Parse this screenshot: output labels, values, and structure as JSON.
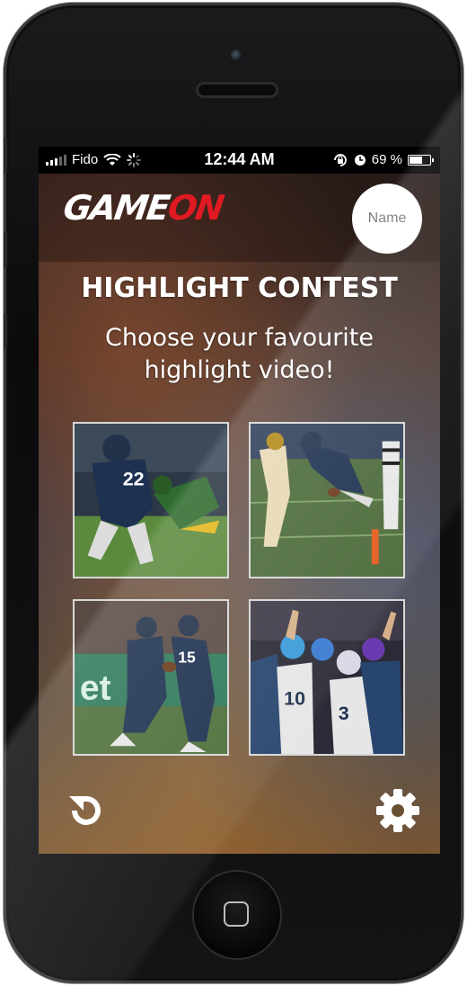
{
  "status_bar": {
    "carrier": "Fido",
    "time": "12:44 AM",
    "battery": "69 %",
    "battery_level": 0.69
  },
  "header": {
    "logo_main": "GAME",
    "logo_accent": "ON",
    "name_button": "Name"
  },
  "content": {
    "title": "HIGHLIGHT CONTEST",
    "subtitle": "Choose your favourite highlight video!",
    "videos": [
      {
        "icon": "football-tackle-thumbnail"
      },
      {
        "icon": "football-catch-thumbnail"
      },
      {
        "icon": "football-handoff-thumbnail"
      },
      {
        "icon": "fans-celebrating-thumbnail"
      }
    ]
  },
  "footer": {
    "left_icon": "refresh-icon",
    "right_icon": "gear-icon"
  },
  "colors": {
    "accent": "#e01a22",
    "team_navy": "#1e3150",
    "field_green": "#4f7a3a"
  }
}
